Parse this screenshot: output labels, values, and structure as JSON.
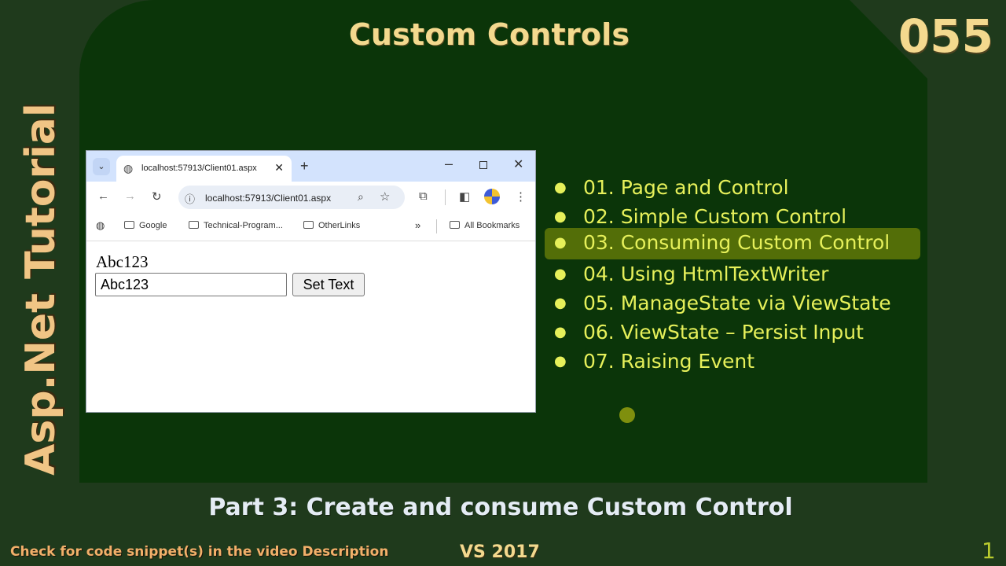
{
  "slide": {
    "title": "Custom Controls",
    "episode": "055",
    "series_title": "Asp.Net Tutorial",
    "subtitle": "Part 3: Create and consume Custom Control",
    "footer_note": "Check for code snippet(s) in the video Description",
    "version": "VS 2017",
    "page_number": "1"
  },
  "browser": {
    "tab_title": "localhost:57913/Client01.aspx",
    "url": "localhost:57913/Client01.aspx",
    "bookmarks": [
      "Google",
      "Technical-Program...",
      "OtherLinks"
    ],
    "all_bookmarks": "All Bookmarks",
    "page": {
      "label_text": "Abc123",
      "input_value": "Abc123",
      "button_label": "Set Text"
    }
  },
  "lessons": [
    {
      "label": "01. Page and Control",
      "active": false
    },
    {
      "label": "02. Simple Custom Control",
      "active": false
    },
    {
      "label": "03. Consuming Custom Control",
      "active": true
    },
    {
      "label": "04. Using HtmlTextWriter",
      "active": false
    },
    {
      "label": "05. ManageState via ViewState",
      "active": false
    },
    {
      "label": "06. ViewState – Persist Input",
      "active": false
    },
    {
      "label": "07. Raising Event",
      "active": false
    }
  ],
  "colors": {
    "background": "#1f3a1c",
    "panel": "#0b3509",
    "title": "#f3d98e",
    "lesson_text": "#e6f05a",
    "lesson_highlight": "#536e08"
  }
}
